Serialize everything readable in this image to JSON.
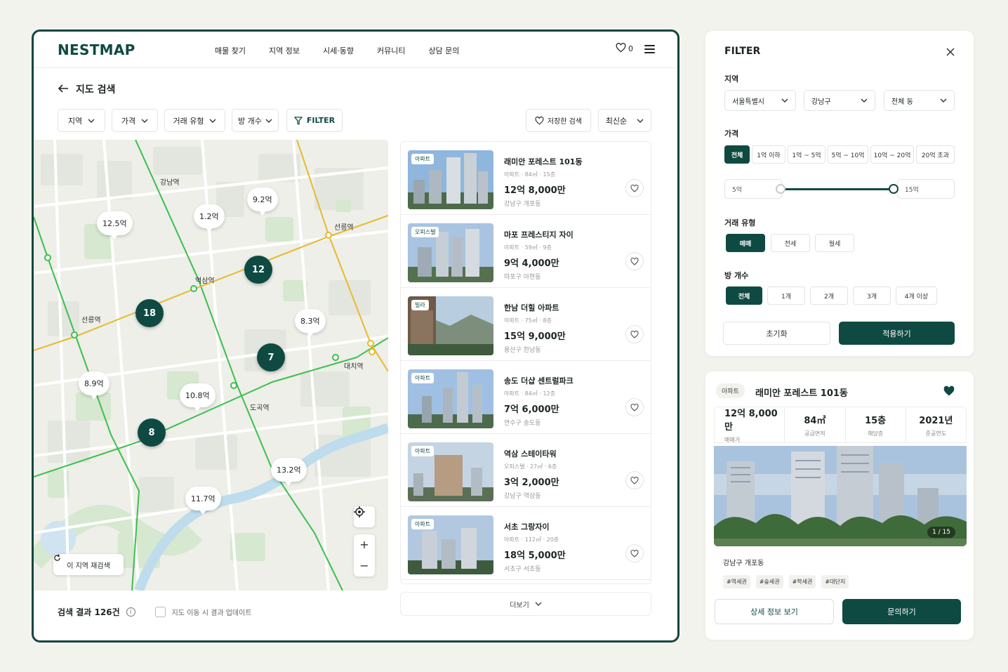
{
  "app": {
    "logo": "NESTMAP",
    "nav": [
      "매물 찾기",
      "지역 정보",
      "시세·동향",
      "커뮤니티",
      "상담 문의"
    ],
    "favorite_count": "0"
  },
  "search": {
    "title": "지도 검색",
    "filters": [
      "지역",
      "가격",
      "거래 유형",
      "방 개수"
    ],
    "filter_button": "FILTER",
    "saved_search": "저장한 검색",
    "sort": "최신순"
  },
  "map": {
    "stations": [
      "강남역",
      "선릉역",
      "역삼역",
      "선릉역",
      "대치역",
      "도곡역"
    ],
    "price_bubbles": [
      "12.5억",
      "1.2억",
      "9.2억",
      "8.3억",
      "8.9억",
      "10.8억",
      "13.2억",
      "11.7억"
    ],
    "clusters": [
      "12",
      "18",
      "7",
      "8"
    ],
    "research_button": "이 지역 재검색",
    "zoom_in": "+",
    "zoom_out": "−"
  },
  "results": {
    "count_label": "검색 결과 126건",
    "auto_update_label": "지도 이동 시 결과 업데이트",
    "more_label": "더보기"
  },
  "listings": [
    {
      "tag": "아파트",
      "title": "래미안 포레스트 101동",
      "meta": "아파트 · 84㎡ · 15층",
      "price": "12억 8,000만",
      "location": "강남구 개포동"
    },
    {
      "tag": "오피스텔",
      "title": "마포 프레스티지 자이",
      "meta": "아파트 · 59㎡ · 9층",
      "price": "9억 4,000만",
      "location": "마포구 아현동"
    },
    {
      "tag": "빌라",
      "title": "한남 더힐 아파트",
      "meta": "아파트 · 75㎡ · 8층",
      "price": "15억 9,000만",
      "location": "용산구 한남동"
    },
    {
      "tag": "아파트",
      "title": "송도 더샵 센트럴파크",
      "meta": "아파트 · 84㎡ · 12층",
      "price": "7억 6,000만",
      "location": "연수구 송도동"
    },
    {
      "tag": "아파트",
      "title": "역삼 스테이타워",
      "meta": "오피스텔 · 27㎡ · 6층",
      "price": "3억 2,000만",
      "location": "강남구 역삼동"
    },
    {
      "tag": "아파트",
      "title": "서초 그랑자이",
      "meta": "아파트 · 112㎡ · 20층",
      "price": "18억 5,000만",
      "location": "서초구 서초동"
    }
  ],
  "filter_panel": {
    "title": "FILTER",
    "region_label": "지역",
    "region_selects": [
      "서울특별시",
      "강남구",
      "전체 동"
    ],
    "price_label": "가격",
    "price_options": [
      "전체",
      "1억 이하",
      "1억 ~ 5억",
      "5억 ~ 10억",
      "10억 ~ 20억",
      "20억 초과"
    ],
    "price_active_index": 0,
    "range_min": "5억",
    "range_max": "15억",
    "deal_label": "거래 유형",
    "deal_options": [
      "매매",
      "전세",
      "월세"
    ],
    "room_label": "방 개수",
    "room_options": [
      "전체",
      "1개",
      "2개",
      "3개",
      "4개 이상"
    ],
    "reset_label": "초기화",
    "apply_label": "적용하기"
  },
  "detail": {
    "tag": "아파트",
    "title": "래미안 포레스트 101동",
    "stats": [
      {
        "value": "12억 8,000만",
        "label": "매매가"
      },
      {
        "value": "84㎡",
        "label": "공급면적"
      },
      {
        "value": "15층",
        "label": "해당층"
      },
      {
        "value": "2021년",
        "label": "준공연도"
      }
    ],
    "photo_counter": "1 / 15",
    "location": "강남구 개포동",
    "hashtags": [
      "#역세권",
      "#숲세권",
      "#학세권",
      "#대단지"
    ],
    "detail_button": "상세 정보 보기",
    "inquiry_button": "문의하기"
  },
  "colors": {
    "brand": "#0f4a42",
    "metro_green": "#3cbf4e",
    "metro_yellow": "#e8b930"
  }
}
